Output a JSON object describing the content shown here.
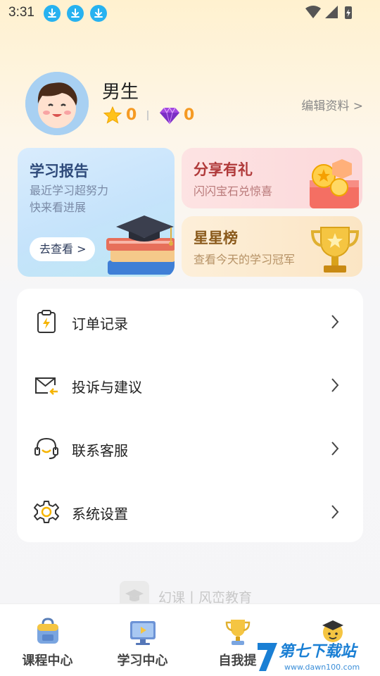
{
  "status_bar": {
    "time": "3:31"
  },
  "profile": {
    "username": "男生",
    "stars": "0",
    "gems": "0",
    "edit_label": "编辑资料 >"
  },
  "cards": {
    "report": {
      "title": "学习报告",
      "line1": "最近学习超努力",
      "line2": "快来看进展",
      "button": "去查看 >"
    },
    "share": {
      "title": "分享有礼",
      "subtitle": "闪闪宝石兑惊喜"
    },
    "rank": {
      "title": "星星榜",
      "subtitle": "查看今天的学习冠军"
    }
  },
  "menu": [
    {
      "label": "订单记录",
      "icon": "order-record-icon"
    },
    {
      "label": "投诉与建议",
      "icon": "mail-feedback-icon"
    },
    {
      "label": "联系客服",
      "icon": "headset-icon"
    },
    {
      "label": "系统设置",
      "icon": "gear-icon"
    }
  ],
  "brand": {
    "text": "幻课丨风峦教育"
  },
  "bottom_nav": [
    {
      "label": "课程中心",
      "icon": "backpack-icon"
    },
    {
      "label": "学习中心",
      "icon": "monitor-icon"
    },
    {
      "label": "自我提",
      "icon": "trophy-icon"
    },
    {
      "label": "",
      "icon": "student-icon"
    }
  ],
  "watermark": {
    "text": "第七下载站",
    "url": "www.dawn100.com"
  },
  "colors": {
    "accent_orange": "#f59a23",
    "report_title": "#2e4a7a",
    "share_title": "#b03a3a",
    "rank_title": "#8a5a1c"
  }
}
